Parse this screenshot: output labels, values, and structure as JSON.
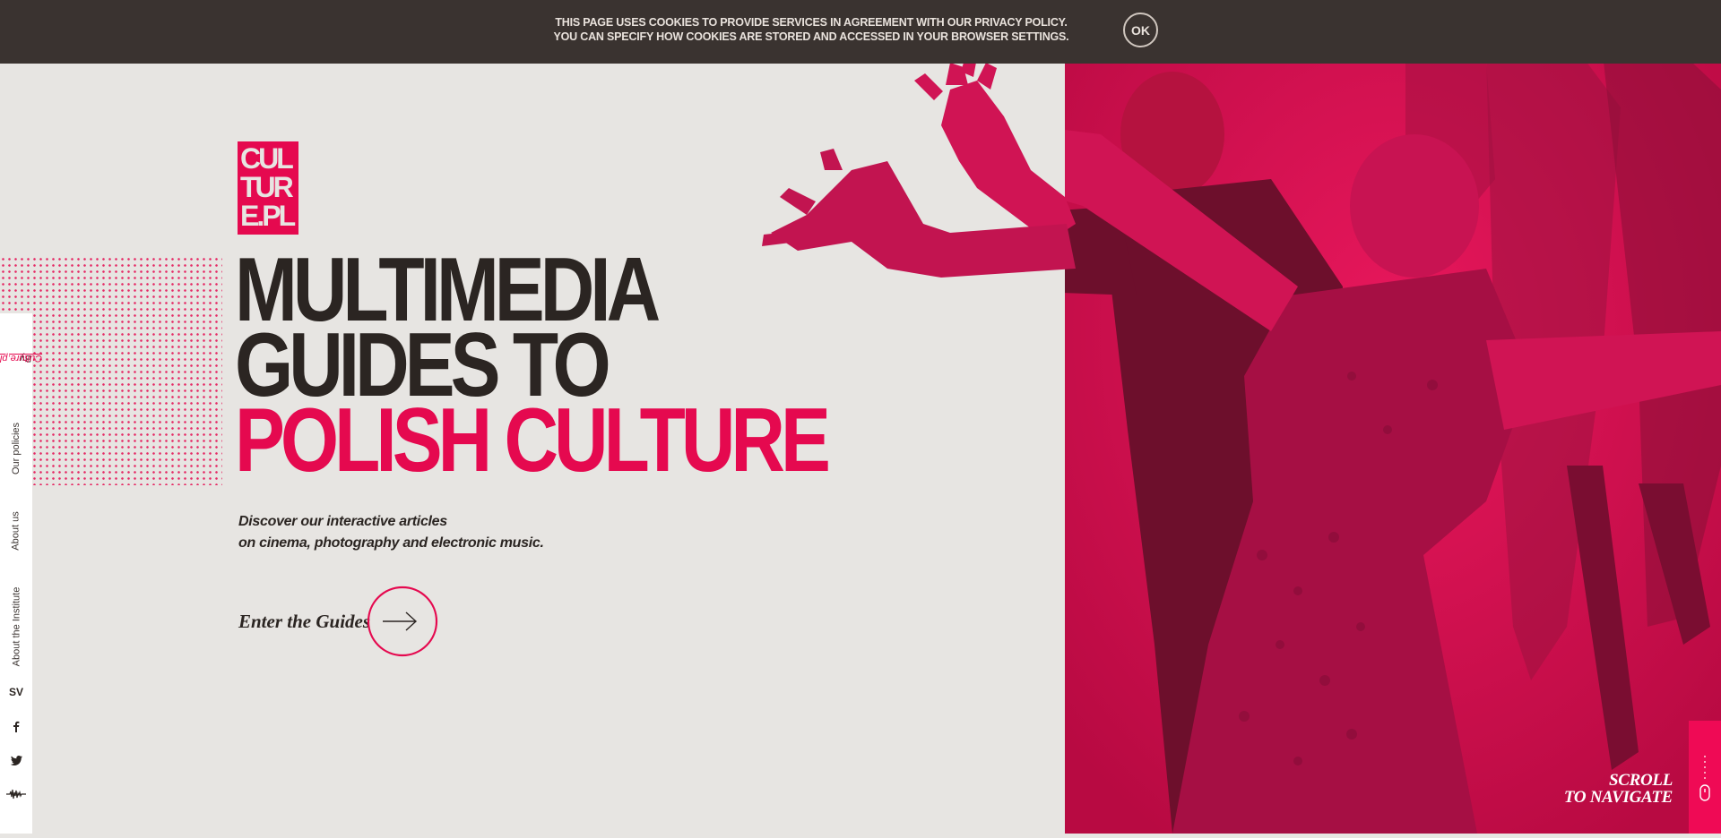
{
  "cookie": {
    "line1": "THIS PAGE USES COOKIES TO PROVIDE SERVICES IN AGREEMENT WITH OUR PRIVACY POLICY.",
    "line2": "YOU CAN SPECIFY HOW COOKIES ARE STORED AND ACCESSED IN YOUR BROWSER SETTINGS.",
    "ok_label": "OK"
  },
  "sidebar": {
    "by_prefix": "By ",
    "by_link": "Culture.pl",
    "our_policies": "Our policies",
    "about_us": "About us",
    "about_institute": "About the Institute",
    "language": "SV",
    "icons": [
      "facebook-icon",
      "twitter-icon",
      "soundwave-icon"
    ]
  },
  "logo": {
    "text": "CULTURE.PL"
  },
  "headline": {
    "line1": "MULTIMEDIA",
    "line2": "GUIDES TO",
    "line3": "POLISH CULTURE"
  },
  "subtitle": {
    "line1": "Discover our interactive articles",
    "line2": "on cinema, photography and electronic music."
  },
  "cta": {
    "label": "Enter the Guides"
  },
  "scroll": {
    "line1": "SCROLL",
    "line2": "TO NAVIGATE"
  },
  "colors": {
    "accent": "#e5094f",
    "dark": "#2b2522",
    "cookie_bar": "#3a3330",
    "background": "#e7e5e2",
    "hero": "#d6104e"
  }
}
